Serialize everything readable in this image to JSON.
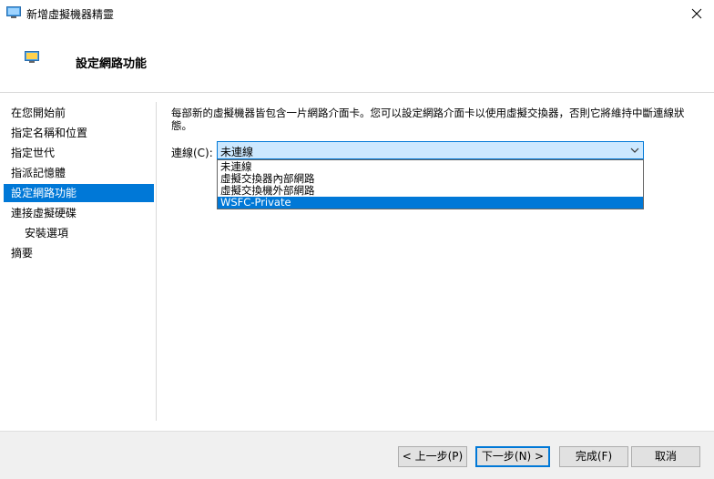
{
  "window": {
    "title": "新增虛擬機器精靈"
  },
  "header": {
    "title": "設定網路功能"
  },
  "sidebar": {
    "items": [
      {
        "label": "在您開始前"
      },
      {
        "label": "指定名稱和位置"
      },
      {
        "label": "指定世代"
      },
      {
        "label": "指派記憶體"
      },
      {
        "label": "設定網路功能"
      },
      {
        "label": "連接虛擬硬碟"
      },
      {
        "label": "安裝選項"
      },
      {
        "label": "摘要"
      }
    ]
  },
  "main": {
    "description": "每部新的虛擬機器皆包含一片網路介面卡。您可以設定網路介面卡以使用虛擬交換器，否則它將維持中斷連線狀態。",
    "connection_label": "連線(C):",
    "connection_value": "未連線",
    "options": [
      {
        "label": "未連線"
      },
      {
        "label": "虛擬交換器內部網路"
      },
      {
        "label": "虛擬交換機外部網路"
      },
      {
        "label": "WSFC-Private"
      }
    ]
  },
  "footer": {
    "previous": "< 上一步(P)",
    "next": "下一步(N) >",
    "finish": "完成(F)",
    "cancel": "取消"
  },
  "colors": {
    "accent": "#0078d7",
    "selection_bg": "#cce8ff",
    "footer_bg": "#f0f0f0"
  },
  "icons": {
    "app": "hyperv-monitor-icon",
    "close": "close-icon",
    "dropdown": "chevron-down-icon"
  }
}
